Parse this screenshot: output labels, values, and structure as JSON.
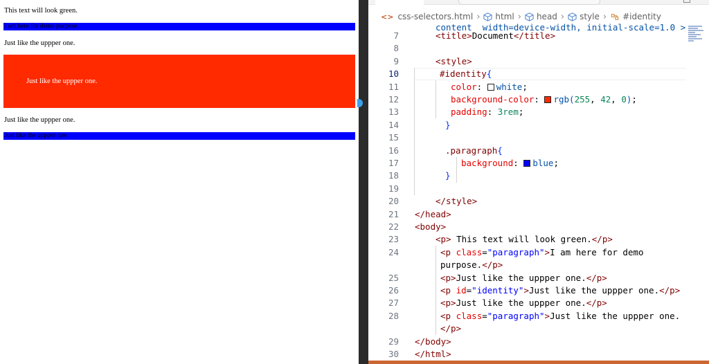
{
  "preview": {
    "line1": "This text will look green.",
    "line2": "I am here for demo purpose.",
    "line3": "Just like the uppper one.",
    "line4": "Just like the uppper one.",
    "line5": "Just like the uppper one.",
    "line6": "Just like the uppper one."
  },
  "breadcrumb": {
    "file": "css-selectors.html",
    "c1": "html",
    "c2": "head",
    "c3": "style",
    "c4": "#identity"
  },
  "editor": {
    "line_numbers": [
      "7",
      "8",
      "9",
      "10",
      "11",
      "12",
      "13",
      "14",
      "15",
      "16",
      "17",
      "18",
      "19",
      "20",
      "21",
      "22",
      "23",
      "24",
      "",
      "25",
      "26",
      "27",
      "28",
      "",
      "29",
      "30"
    ],
    "partial_top": "content  width=device-width, initial-scale=1.0 >",
    "code": {
      "l7_tag_open": "<title>",
      "l7_text": "Document",
      "l7_tag_close": "</title>",
      "l9": "<style>",
      "l10": "#identity",
      "l10_brace": "{",
      "l11_prop": "color",
      "l11_val": "white",
      "l12_prop": "background-color",
      "l12_val_fn": "rgb(",
      "l12_n1": "255",
      "l12_n2": "42",
      "l12_n3": "0",
      "l13_prop": "padding",
      "l13_val": "3rem",
      "l14": "}",
      "l16": ".paragraph",
      "l16_brace": "{",
      "l17_prop": "background",
      "l17_val": "blue",
      "l18": "}",
      "l20": "</style>",
      "l21": "</head>",
      "l22": "<body>",
      "l23_open": "<p>",
      "l23_text": " This text will look green.",
      "l23_close": "</p>",
      "p_open": "<p",
      "class_attr": " class",
      "id_attr": " id",
      "paragraph_str": "\"paragraph\"",
      "identity_str": "\"identity\"",
      "gt": ">",
      "l24_text": "I am here for demo",
      "l24b_text": "purpose.",
      "p_close": "</p>",
      "p_tag": "<p>",
      "uppper": "Just like the uppper one.",
      "l28_text": "Just like the uppper one.",
      "l29": "</body>",
      "l30": "</html>"
    }
  },
  "colors": {
    "red_box": "#ff2a00",
    "blue_bar": "#0000ff",
    "swatch_white": "#ffffff",
    "swatch_red": "#ff2a00",
    "swatch_blue": "#0000ff",
    "statusbar": "#cc6633"
  }
}
